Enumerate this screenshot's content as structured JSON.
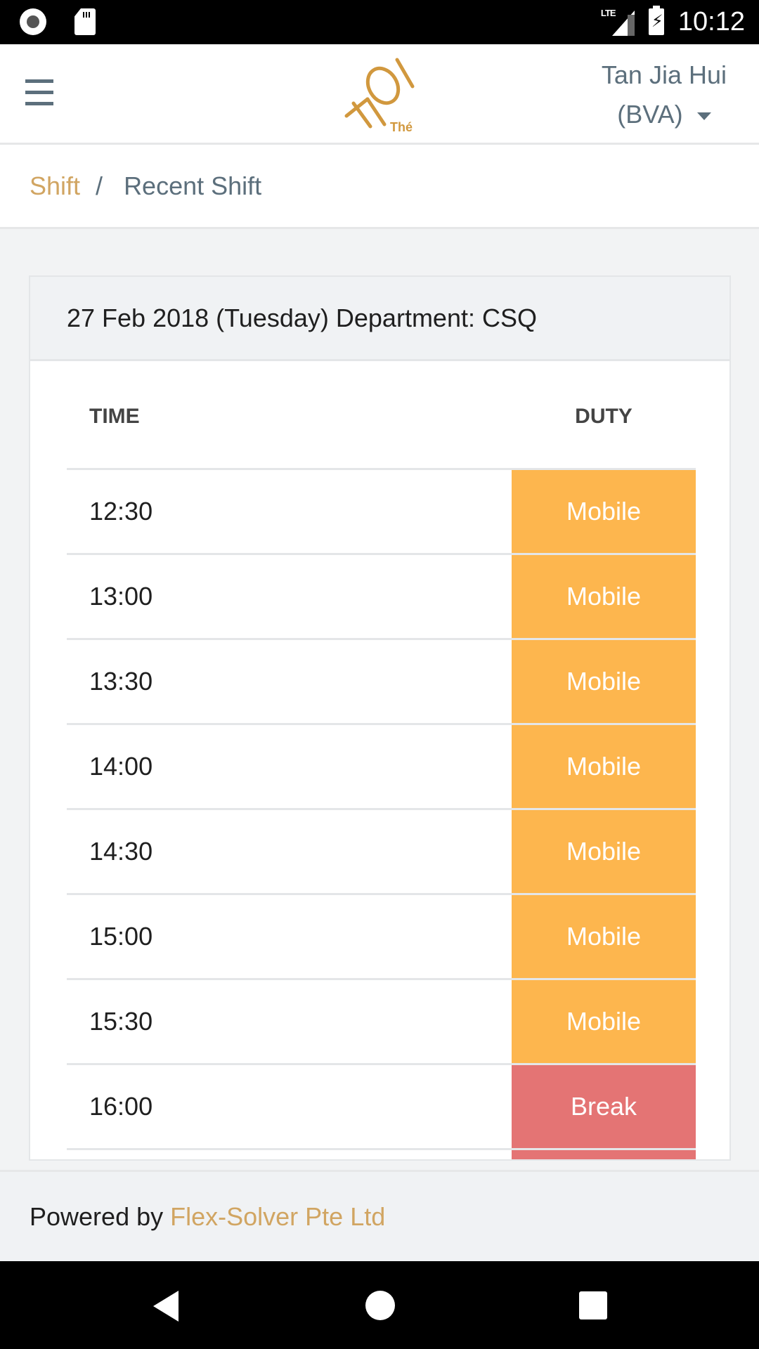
{
  "status_bar": {
    "time": "10:12",
    "network": "LTE",
    "battery_text": "⚡"
  },
  "header": {
    "menu_icon": "hamburger-icon",
    "logo_text": "KOI",
    "logo_subtext": "Thé",
    "user_name": "Tan Jia Hui",
    "user_code": "(BVA)"
  },
  "breadcrumb": {
    "parent": "Shift",
    "separator": "/",
    "current": "Recent Shift"
  },
  "card": {
    "title": "27 Feb 2018 (Tuesday) Department: CSQ",
    "columns": [
      "TIME",
      "DUTY"
    ],
    "rows": [
      {
        "time": "12:30",
        "duty": "Mobile"
      },
      {
        "time": "13:00",
        "duty": "Mobile"
      },
      {
        "time": "13:30",
        "duty": "Mobile"
      },
      {
        "time": "14:00",
        "duty": "Mobile"
      },
      {
        "time": "14:30",
        "duty": "Mobile"
      },
      {
        "time": "15:00",
        "duty": "Mobile"
      },
      {
        "time": "15:30",
        "duty": "Mobile"
      },
      {
        "time": "16:00",
        "duty": "Break"
      },
      {
        "time": "",
        "duty": ""
      }
    ]
  },
  "duty_colors": {
    "Mobile": "#fdb64e",
    "Break": "#e47474"
  },
  "footer": {
    "prefix": "Powered by",
    "link": "Flex-Solver Pte Ltd"
  },
  "colors": {
    "accent": "#d1a562",
    "muted": "#5c6f7c"
  }
}
